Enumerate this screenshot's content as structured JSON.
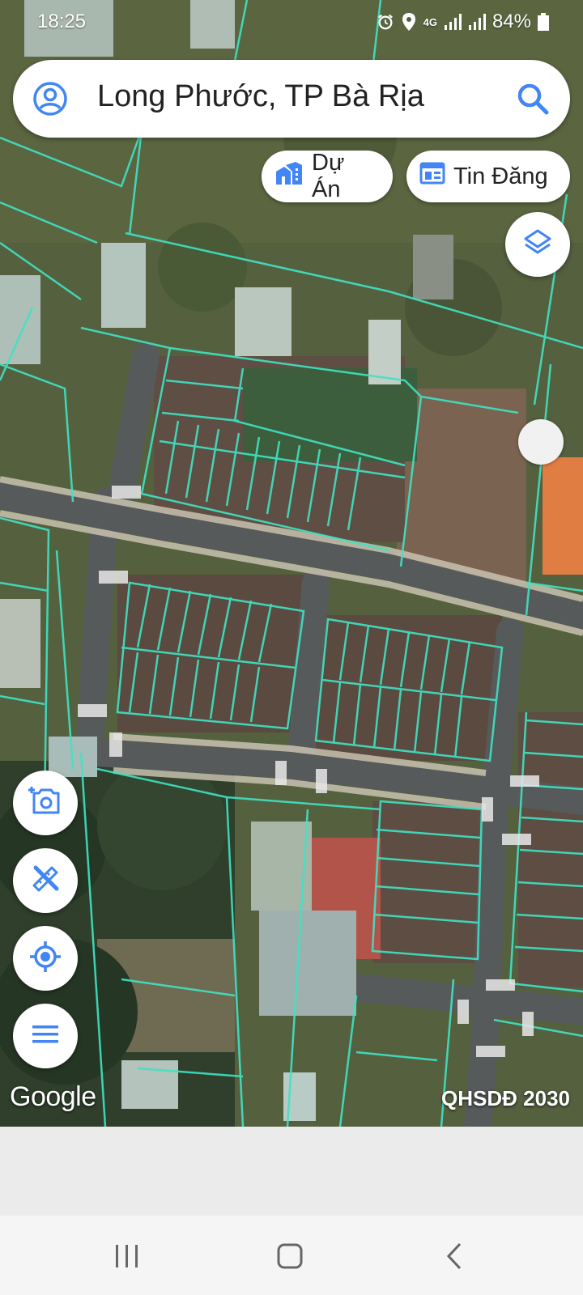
{
  "status_bar": {
    "time": "18:25",
    "network": "4G",
    "battery": "84%"
  },
  "search": {
    "query": "Long Phước, TP Bà Rịa"
  },
  "chips": {
    "projects_label": "Dự Án",
    "listings_label": "Tin Đăng"
  },
  "map": {
    "attribution": "Google",
    "layer_label": "QHSDĐ 2030",
    "parcel_line_color": "#3fe3c4",
    "accent_color": "#4285f4"
  },
  "icons": {
    "user": "account-circle-icon",
    "search": "search-icon",
    "projects": "building-icon",
    "listings": "listing-icon",
    "layers": "layers-icon",
    "camera": "add-photo-icon",
    "measure": "ruler-pencil-icon",
    "location": "my-location-icon",
    "menu": "menu-icon"
  }
}
